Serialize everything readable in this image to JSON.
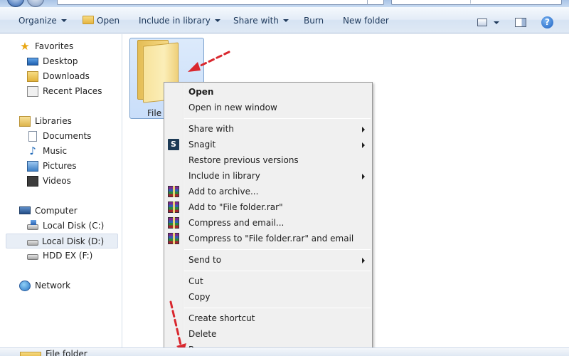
{
  "toolbar": {
    "organize": "Organize",
    "open": "Open",
    "include_in_library": "Include in library",
    "share_with": "Share with",
    "burn": "Burn",
    "new_folder": "New folder",
    "help": "?"
  },
  "nav": {
    "favorites": "Favorites",
    "desktop": "Desktop",
    "downloads": "Downloads",
    "recent_places": "Recent Places",
    "libraries": "Libraries",
    "documents": "Documents",
    "music": "Music",
    "pictures": "Pictures",
    "videos": "Videos",
    "computer": "Computer",
    "local_disk_c": "Local Disk (C:)",
    "local_disk_d": "Local Disk (D:)",
    "hdd_ex": "HDD EX (F:)",
    "network": "Network"
  },
  "content": {
    "folder_label": "File",
    "details_text": "File folder"
  },
  "context_menu": {
    "open": "Open",
    "open_new_window": "Open in new window",
    "share_with": "Share with",
    "snagit": "Snagit",
    "restore_previous": "Restore previous versions",
    "include_in_library": "Include in library",
    "add_to_archive": "Add to archive...",
    "add_to_rar": "Add to \"File folder.rar\"",
    "compress_email": "Compress and email...",
    "compress_rar_email": "Compress to \"File folder.rar\" and email",
    "send_to": "Send to",
    "cut": "Cut",
    "copy": "Copy",
    "create_shortcut": "Create shortcut",
    "delete": "Delete",
    "rename": "Rename",
    "snagit_icon_letter": "S"
  },
  "colors": {
    "accent_text": "#1e395b",
    "selection_fill": "#c9defa",
    "arrow_red": "#d9272e"
  }
}
